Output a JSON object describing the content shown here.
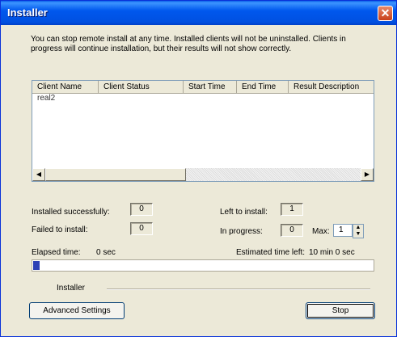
{
  "window": {
    "title": "Installer"
  },
  "message": "You can stop remote install at any time. Installed clients will not be uninstalled. Clients in progress will continue installation, but their results will not show correctly.",
  "table": {
    "columns": [
      "Client Name",
      "Client Status",
      "Start Time",
      "End Time",
      "Result Description"
    ],
    "rows": [
      {
        "client_name": "real2"
      }
    ]
  },
  "stats": {
    "installed_label": "Installed successfully:",
    "installed_value": "0",
    "failed_label": "Failed to install:",
    "failed_value": "0",
    "left_label": "Left to install:",
    "left_value": "1",
    "inprogress_label": "In progress:",
    "inprogress_value": "0",
    "max_label": "Max:",
    "max_value": "1"
  },
  "time": {
    "elapsed_label": "Elapsed time:",
    "elapsed_value": "0 sec",
    "estimated_label": "Estimated time left:",
    "estimated_value": "10 min 0 sec"
  },
  "progress": {
    "fraction": 0.02
  },
  "group": {
    "label": "Installer"
  },
  "buttons": {
    "advanced": "Advanced Settings",
    "stop": "Stop"
  },
  "colors": {
    "title_bar": "#0058ee",
    "progress_fill": "#2c40b5",
    "close": "#c8401b"
  }
}
